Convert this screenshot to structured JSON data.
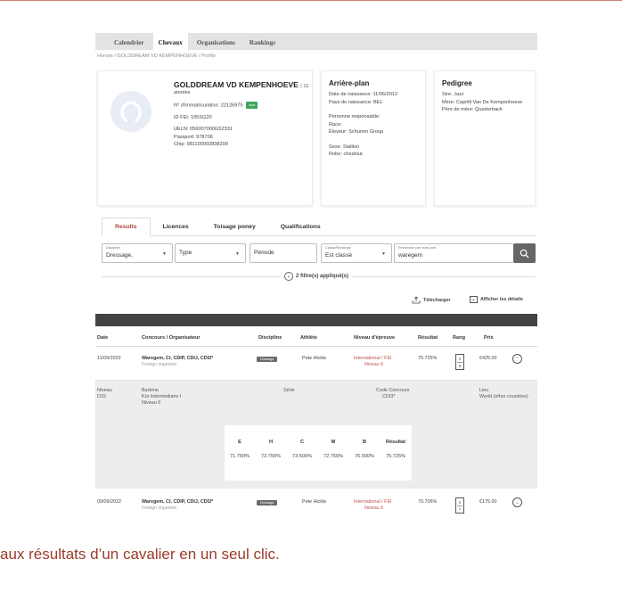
{
  "nav": {
    "items": [
      "Calendrier",
      "Chevaux",
      "Organisations",
      "Rankings"
    ],
    "active": "Chevaux"
  },
  "breadcrumb": "Horses / GOLDDREAM VD KEMPENHOEVE / Profile",
  "horse": {
    "name": "GOLDDREAM VD KEMPENHOEVE",
    "age": "| 11",
    "age_unit": "années",
    "registration": "N° d'immatriculation: 22126975",
    "status_badge": "actif",
    "fei_id": "ID FEI: 105SG20",
    "ueln": "UELN: 056007000G52331",
    "passport": "Passport: 978706",
    "chip": "Chip: 981100002838299"
  },
  "background": {
    "title": "Arrière-plan",
    "birth_date": "Date de naissance: 11/06/2012",
    "birth_country": "Pays de naissance: BEL",
    "responsible": "Personne responsable:",
    "breed": "Race:",
    "breeder": "Éleveur: Schumm Group",
    "sex": "Sexe: Stallion",
    "coat": "Robe: chestnut"
  },
  "pedigree": {
    "title": "Pedigree",
    "sire": "Sire: Jazz",
    "dam": "Mère: Caprilli Van De Kempenhoeve",
    "dam_sire": "Père de mère: Quarterback"
  },
  "tabs": [
    "Results",
    "Licences",
    "Toisage poney",
    "Qualifications"
  ],
  "filters": {
    "discipline_label": "Discipline",
    "discipline_value": "Dressage,",
    "type_value": "Type",
    "period_value": "Période",
    "ranked_label": "Classé/Rankings",
    "ranked_value": "Est classé",
    "search_label": "Recherche par mots-clés",
    "search_value": "waregem",
    "applied": "2 filtre(s) appliqué(s)"
  },
  "actions": {
    "download": "Télécharger",
    "details": "Afficher les détails"
  },
  "table": {
    "headers": [
      "Date",
      "Concours / Organisateur",
      "Discipline",
      "Athlète",
      "Niveau d'épreuve",
      "Résultat",
      "Rang",
      "Prix"
    ],
    "rows": [
      {
        "date": "11/09/2022",
        "event": "Waregem, CI, CDIP, CDIJ, CDI3*",
        "organiser": "Foreign organiser",
        "discipline": "Dressage",
        "athlete": "Pete Hickle",
        "level": "International / FEI",
        "level_sub": "Niveau 6",
        "result": "75.725%",
        "rank_top": "2",
        "rank_bottom": "8",
        "prize": "€425.00"
      },
      {
        "date": "09/09/2022",
        "event": "Waregem, CI, CDIP, CDIJ, CDI3*",
        "organiser": "Foreign organiser",
        "discipline": "Dressage",
        "athlete": "Pete Hickle",
        "level": "International / FEI",
        "level_sub": "Niveau 6",
        "result": "70.706%",
        "rank_top": "2",
        "rank_bottom": "7",
        "prize": "€175.00"
      }
    ]
  },
  "detail": {
    "niveau_label": "Niveau",
    "niveau_value": "D15",
    "bareme_label": "Barème",
    "bareme_value": "Kür Intermediaire I",
    "bareme_level": "Niveau 6",
    "serie_label": "Série",
    "code_label": "Code Concours",
    "code_value": "CDI3*",
    "lieu_label": "Lieu",
    "lieu_value": "World (other countries)",
    "score_headers": [
      "E",
      "H",
      "C",
      "M",
      "B",
      "Résultat"
    ],
    "score_values": [
      "71.750%",
      "72.750%",
      "73.500%",
      "72.750%",
      "76.500%",
      "75.725%"
    ]
  },
  "tagline": "aux résultats d’un cavalier en un seul clic."
}
